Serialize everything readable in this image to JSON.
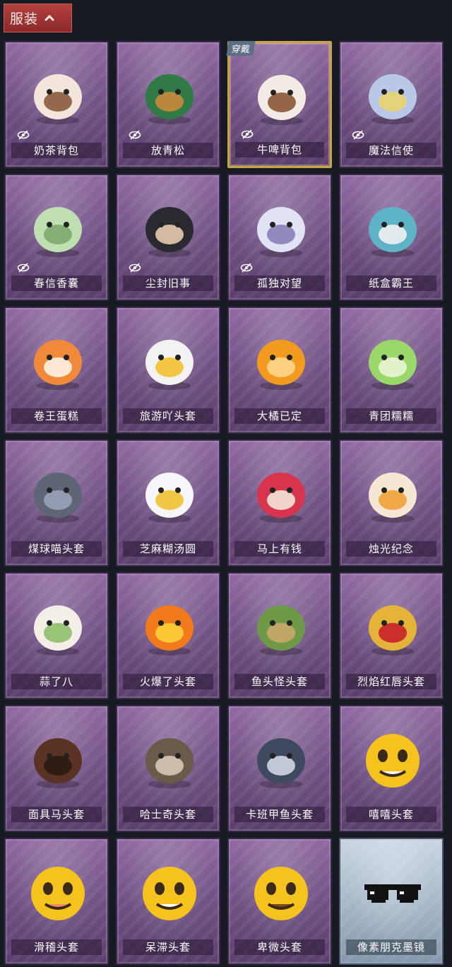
{
  "header": {
    "section_label": "服装",
    "section_icon": "chevron-up-icon"
  },
  "items": [
    {
      "name": "奶茶背包",
      "hidden": true,
      "icon": "milk-tea-backpack"
    },
    {
      "name": "放青松",
      "hidden": true,
      "icon": "pine-tree-pot"
    },
    {
      "name": "牛啤背包",
      "hidden": true,
      "icon": "cow-beer-backpack",
      "selected": true,
      "badge": "穿戴"
    },
    {
      "name": "魔法信使",
      "hidden": true,
      "icon": "elephant-messenger"
    },
    {
      "name": "春信香囊",
      "hidden": true,
      "icon": "sachet"
    },
    {
      "name": "尘封旧事",
      "hidden": true,
      "icon": "figure-charm"
    },
    {
      "name": "孤独对望",
      "hidden": true,
      "icon": "angel-charm"
    },
    {
      "name": "纸盒霸王",
      "hidden": false,
      "icon": "box-dino"
    },
    {
      "name": "卷王蛋糕",
      "hidden": false,
      "icon": "roll-cake"
    },
    {
      "name": "旅游吖头套",
      "hidden": false,
      "icon": "duck-hat"
    },
    {
      "name": "大橘已定",
      "hidden": false,
      "icon": "orange-slice"
    },
    {
      "name": "青团糯糯",
      "hidden": false,
      "icon": "green-rice-ball"
    },
    {
      "name": "煤球喵头套",
      "hidden": false,
      "icon": "cat-head"
    },
    {
      "name": "芝麻糊汤圆",
      "hidden": false,
      "icon": "rice-dumpling"
    },
    {
      "name": "马上有钱",
      "hidden": false,
      "icon": "red-horse"
    },
    {
      "name": "烛光纪念",
      "hidden": false,
      "icon": "candle"
    },
    {
      "name": "蒜了八",
      "hidden": false,
      "icon": "garlic"
    },
    {
      "name": "火爆了头套",
      "hidden": false,
      "icon": "fire-head"
    },
    {
      "name": "鱼头怪头套",
      "hidden": false,
      "icon": "fish-head"
    },
    {
      "name": "烈焰红唇头套",
      "hidden": false,
      "icon": "red-lips-mask"
    },
    {
      "name": "面具马头套",
      "hidden": false,
      "icon": "horse-mask"
    },
    {
      "name": "哈士奇头套",
      "hidden": false,
      "icon": "husky-head"
    },
    {
      "name": "卡班甲鱼头套",
      "hidden": false,
      "icon": "turtle-head"
    },
    {
      "name": "嘻嘻头套",
      "hidden": false,
      "icon": "grin-emoji"
    },
    {
      "name": "滑稽头套",
      "hidden": false,
      "icon": "funny-emoji"
    },
    {
      "name": "呆滞头套",
      "hidden": false,
      "icon": "stare-emoji"
    },
    {
      "name": "卑微头套",
      "hidden": false,
      "icon": "humble-emoji"
    },
    {
      "name": "像素朋克墨镜",
      "hidden": false,
      "icon": "pixel-sunglasses",
      "variant": "blue"
    }
  ]
}
